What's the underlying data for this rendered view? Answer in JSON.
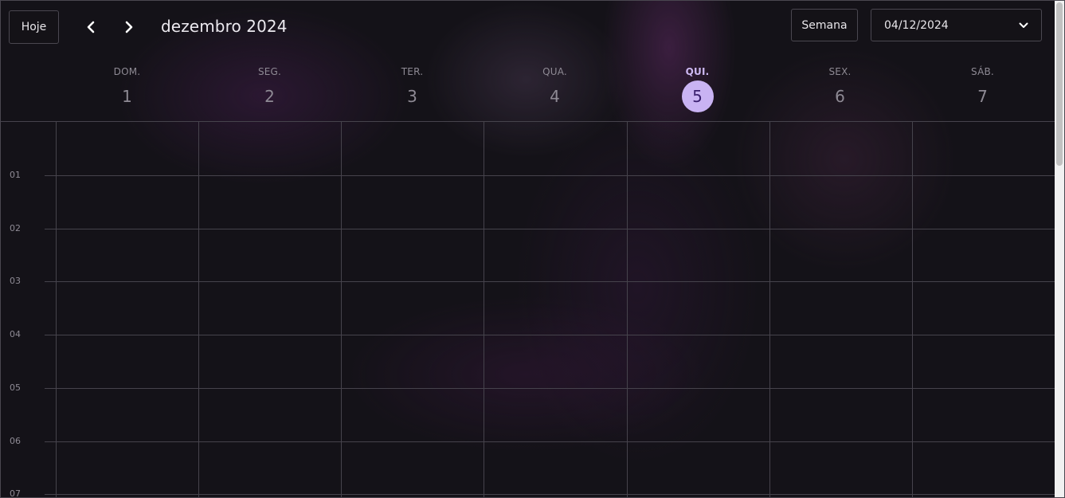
{
  "toolbar": {
    "today_label": "Hoje",
    "prev_icon": "chevron-left-icon",
    "next_icon": "chevron-right-icon",
    "month_title": "dezembro 2024",
    "view_label": "Semana",
    "date_value": "04/12/2024",
    "date_dropdown_icon": "chevron-down-icon"
  },
  "week": {
    "days": [
      {
        "dow": "DOM.",
        "num": "1"
      },
      {
        "dow": "SEG.",
        "num": "2"
      },
      {
        "dow": "TER.",
        "num": "3"
      },
      {
        "dow": "QUA.",
        "num": "4"
      },
      {
        "dow": "QUI.",
        "num": "5"
      },
      {
        "dow": "SEX.",
        "num": "6"
      },
      {
        "dow": "SÁB.",
        "num": "7"
      }
    ],
    "today_index": 4
  },
  "hours": [
    "01",
    "02",
    "03",
    "04",
    "05",
    "06",
    "07"
  ],
  "colors": {
    "background": "#141218",
    "today_highlight": "#c9b3f3",
    "grid_line": "#46434c",
    "muted_text": "#8e8a94"
  }
}
